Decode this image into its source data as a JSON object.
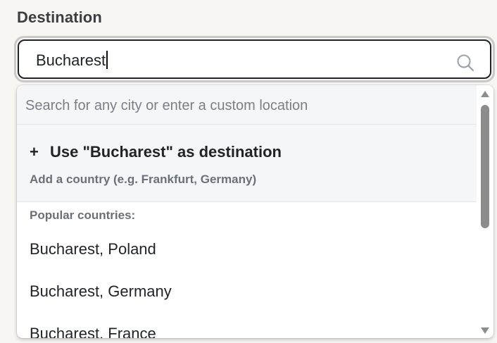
{
  "field": {
    "label": "Destination",
    "value": "Bucharest"
  },
  "dropdown": {
    "search_placeholder": "Search for any city or enter a custom location",
    "use_option": {
      "plus": "+",
      "label": "Use \"Bucharest\" as destination",
      "hint": "Add a country (e.g. Frankfurt, Germany)"
    },
    "section_title": "Popular countries:",
    "suggestions": [
      "Bucharest, Poland",
      "Bucharest, Germany",
      "Bucharest, France"
    ]
  },
  "colors": {
    "text": "#1f2328",
    "muted": "#6b7078",
    "panel": "#f5f6f8",
    "background": "#f8f6f3",
    "scroll_thumb": "#8c8c8c"
  },
  "icons": {
    "search": "search-icon",
    "plus": "plus-icon"
  },
  "scrollbar": {
    "visible_fraction": 0.55,
    "position": 0
  }
}
